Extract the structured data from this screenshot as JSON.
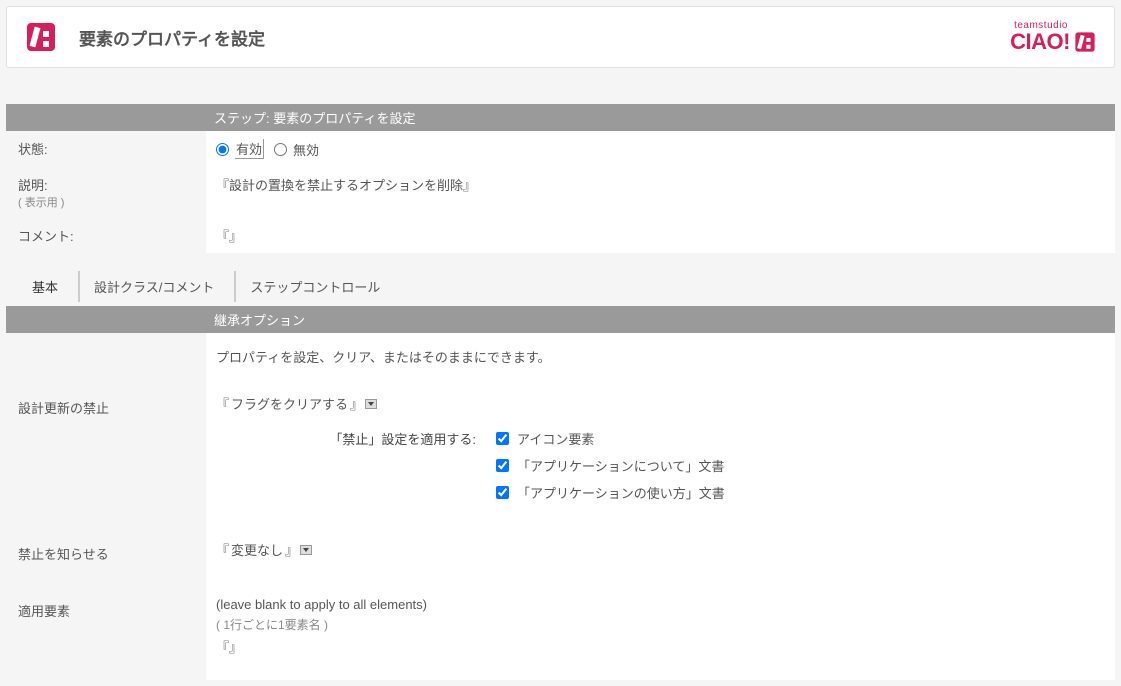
{
  "header": {
    "title": "要素のプロパティを設定",
    "brand_top": "teamstudio",
    "brand_main": "CIAO!"
  },
  "step_title": "ステップ: 要素のプロパティを設定",
  "fields": {
    "status": {
      "label": "状態:",
      "options": {
        "enabled": "有効",
        "disabled": "無効"
      },
      "value": "enabled"
    },
    "description": {
      "label": "説明:",
      "sublabel": "( 表示用 )",
      "value": "設計の置換を禁止するオプションを削除"
    },
    "comment": {
      "label": "コメント:",
      "value": ""
    }
  },
  "tabs": {
    "basic": "基本",
    "design_class": "設計クラス/コメント",
    "step_control": "ステップコントロール"
  },
  "section2": {
    "title": "継承オプション",
    "intro": "プロパティを設定、クリア、またはそのままにできます。",
    "prohibit_update": {
      "label": "設計更新の禁止",
      "value": "フラグをクリアする",
      "apply_label": "「禁止」設定を適用する:",
      "checks": {
        "icon": {
          "label": "アイコン要素",
          "checked": true
        },
        "about": {
          "label": "「アプリケーションについて」文書",
          "checked": true
        },
        "usage": {
          "label": "「アプリケーションの使い方」文書",
          "checked": true
        }
      }
    },
    "notify_prohibit": {
      "label": "禁止を知らせる",
      "value": "変更なし"
    },
    "apply_elements": {
      "label": "適用要素",
      "hint_main": "(leave blank to apply to all elements)",
      "hint_sub": "( 1行ごとに1要素名 )",
      "value": ""
    }
  }
}
